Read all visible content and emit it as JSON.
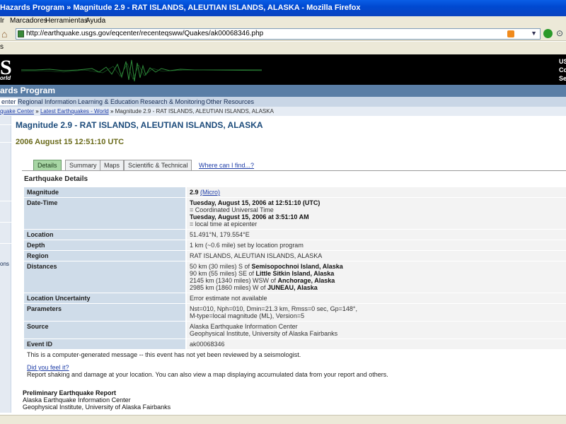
{
  "window": {
    "title": "Hazards Program » Magnitude 2.9 - RAT ISLANDS, ALEUTIAN ISLANDS, ALASKA - Mozilla Firefox"
  },
  "menu": {
    "items": [
      "Ir",
      "Marcadores",
      "Herramientas",
      "Ayuda"
    ]
  },
  "address": {
    "url": "http://earthquake.usgs.gov/eqcenter/recenteqsww/Quakes/ak00068346.php"
  },
  "toolbar2": {
    "label": "s"
  },
  "banner": {
    "logo": "S",
    "logo_sub": "orld",
    "right_lines": [
      "US",
      "Co",
      "Se"
    ]
  },
  "program": {
    "title": "ards Program"
  },
  "nav": {
    "items": [
      "enter",
      "Regional Information",
      "Learning & Education",
      "Research & Monitoring",
      "Other Resources"
    ]
  },
  "breadcrumb": {
    "items": [
      "quake Center",
      "Latest Earthquakes - World",
      "Magnitude 2.9 - RAT ISLANDS, ALEUTIAN ISLANDS, ALASKA"
    ],
    "separator": "»"
  },
  "sidebar": {
    "fragment": "ons"
  },
  "page": {
    "title": "Magnitude 2.9 - RAT ISLANDS, ALEUTIAN ISLANDS, ALASKA",
    "datetime": "2006 August 15 12:51:10 UTC"
  },
  "tabs": {
    "items": [
      "Details",
      "Summary",
      "Maps",
      "Scientific & Technical"
    ],
    "active": "Details",
    "find_link": "Where can I find...?"
  },
  "details": {
    "heading": "Earthquake Details",
    "magnitude_label": "Magnitude",
    "magnitude_value": "2.9",
    "magnitude_type": "(Micro)",
    "datetime_label": "Date-Time",
    "datetime_utc": "Tuesday, August 15, 2006 at 12:51:10 (UTC)",
    "datetime_utc_note": "= Coordinated Universal Time",
    "datetime_local": "Tuesday, August 15, 2006 at 3:51:10 AM",
    "datetime_local_note": "= local time at epicenter",
    "location_label": "Location",
    "location_value": "51.491°N, 179.554°E",
    "depth_label": "Depth",
    "depth_value": "1 km (~0.6 mile) set by location program",
    "region_label": "Region",
    "region_value": "RAT ISLANDS, ALEUTIAN ISLANDS, ALASKA",
    "distances_label": "Distances",
    "distances": [
      {
        "text": "50 km (30 miles) S of ",
        "place": "Semisopochnoi Island, Alaska"
      },
      {
        "text": "90 km (55 miles) SE of ",
        "place": "Little Sitkin Island, Alaska"
      },
      {
        "text": "2145 km (1340 miles) WSW of ",
        "place": "Anchorage, Alaska"
      },
      {
        "text": "2985 km (1860 miles) W of ",
        "place": "JUNEAU, Alaska"
      }
    ],
    "uncertainty_label": "Location Uncertainty",
    "uncertainty_value": "Error estimate not available",
    "parameters_label": "Parameters",
    "parameters_line1": "Nst=010, Nph=010, Dmin=21.3 km, Rmss=0 sec, Gp=148°,",
    "parameters_line2": "M-type=local magnitude (ML), Version=5",
    "source_label": "Source",
    "source_line1": "Alaska Earthquake Information Center",
    "source_line2": "Geophysical Institute, University of Alaska Fairbanks",
    "eventid_label": "Event ID",
    "eventid_value": "ak00068346"
  },
  "notice": "This is a computer-generated message -- this event has not yet been reviewed by a seismologist.",
  "feel": {
    "link": "Did you feel it?",
    "text": "Report shaking and damage at your location. You can also view a map displaying accumulated data from your report and others."
  },
  "preliminary": {
    "title": "Preliminary Earthquake Report",
    "line1": "Alaska Earthquake Information Center",
    "line2": "Geophysical Institute, University of Alaska Fairbanks"
  },
  "colors": {
    "titlebar": "#0a5ee6",
    "banner": "#000000",
    "program_bar": "#5a7ea6",
    "nav_bar": "#c9d6e6",
    "active_tab": "#a7d6a4",
    "label_cell": "#cfdce9",
    "link": "#1f3ea8",
    "heading": "#1b4a7a"
  }
}
